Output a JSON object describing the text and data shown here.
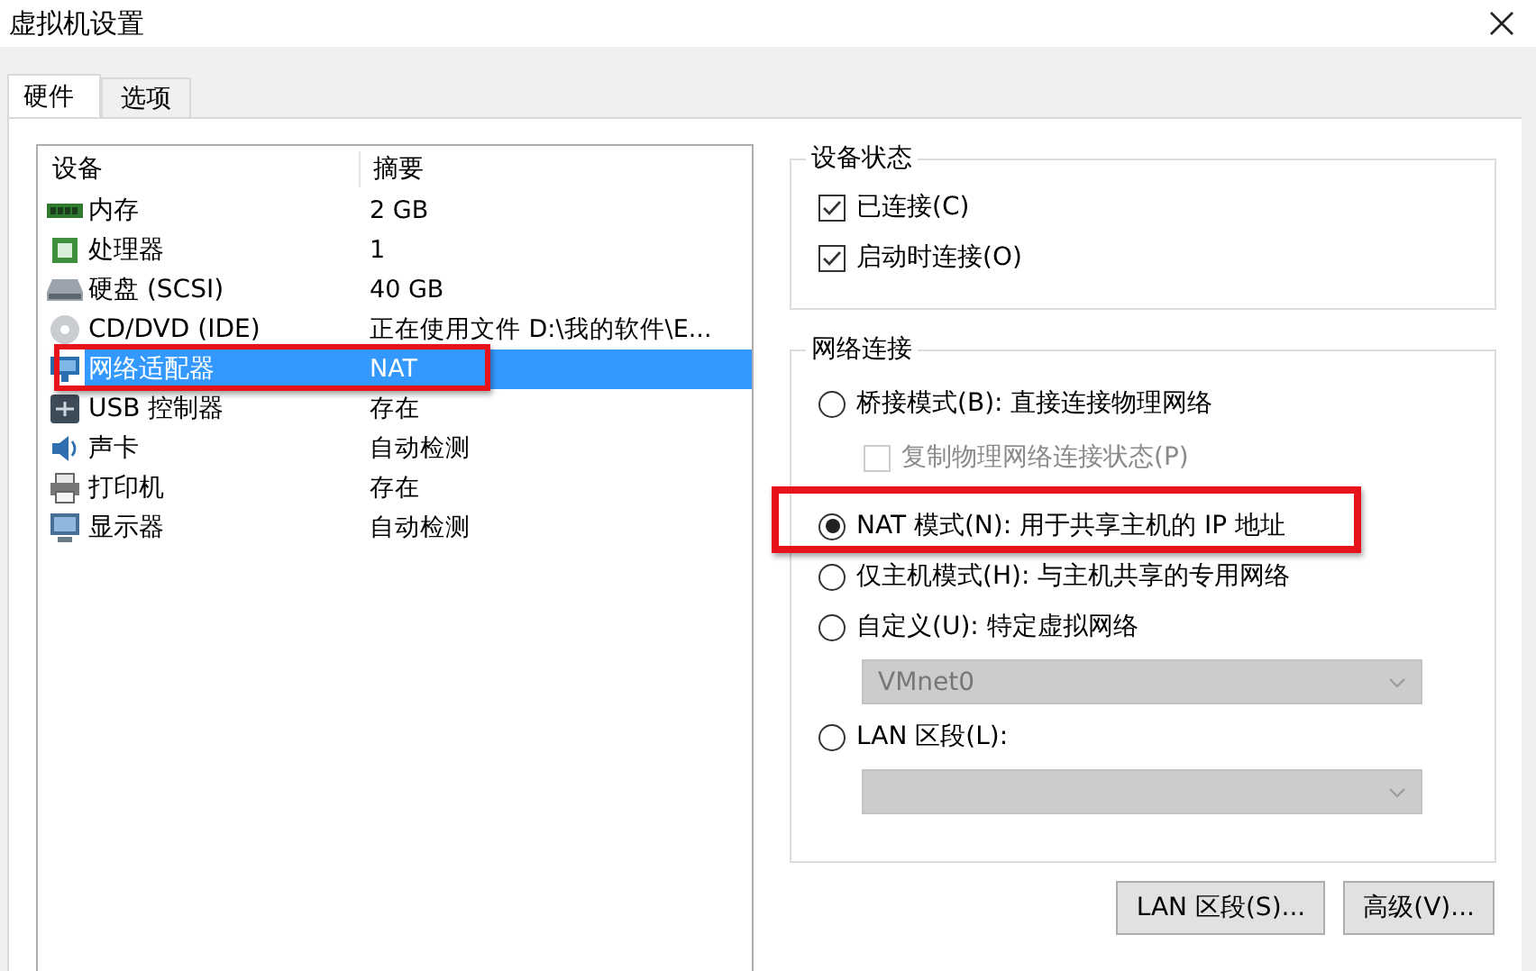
{
  "window": {
    "title": "虚拟机设置"
  },
  "tabs": [
    {
      "label": "硬件",
      "selected": true
    },
    {
      "label": "选项",
      "selected": false
    }
  ],
  "device_list": {
    "columns": [
      "设备",
      "摘要"
    ],
    "rows": [
      {
        "kind": "memory",
        "name": "内存",
        "summary": "2 GB",
        "selected": false
      },
      {
        "kind": "cpu",
        "name": "处理器",
        "summary": "1",
        "selected": false
      },
      {
        "kind": "disk",
        "name": "硬盘 (SCSI)",
        "summary": "40 GB",
        "selected": false
      },
      {
        "kind": "cdrom",
        "name": "CD/DVD (IDE)",
        "summary": "正在使用文件 D:\\我的软件\\E...",
        "selected": false
      },
      {
        "kind": "network",
        "name": "网络适配器",
        "summary": "NAT",
        "selected": true
      },
      {
        "kind": "usb",
        "name": "USB 控制器",
        "summary": "存在",
        "selected": false
      },
      {
        "kind": "sound",
        "name": "声卡",
        "summary": "自动检测",
        "selected": false
      },
      {
        "kind": "printer",
        "name": "打印机",
        "summary": "存在",
        "selected": false
      },
      {
        "kind": "display",
        "name": "显示器",
        "summary": "自动检测",
        "selected": false
      }
    ]
  },
  "device_status": {
    "title": "设备状态",
    "checkboxes": [
      {
        "label": "已连接(C)",
        "checked": true
      },
      {
        "label": "启动时连接(O)",
        "checked": true
      }
    ]
  },
  "network_connection": {
    "title": "网络连接",
    "options": [
      {
        "kind": "radio",
        "label": "桥接模式(B): 直接连接物理网络",
        "selected": false
      },
      {
        "kind": "checkbox",
        "label": "复制物理网络连接状态(P)",
        "checked": false,
        "disabled": true
      },
      {
        "kind": "radio",
        "label": "NAT 模式(N): 用于共享主机的 IP 地址",
        "selected": true
      },
      {
        "kind": "radio",
        "label": "仅主机模式(H): 与主机共享的专用网络",
        "selected": false
      },
      {
        "kind": "radio",
        "label": "自定义(U): 特定虚拟网络",
        "selected": false
      },
      {
        "kind": "dropdown",
        "value": "VMnet0",
        "disabled": true
      },
      {
        "kind": "radio",
        "label": "LAN 区段(L):",
        "selected": false
      },
      {
        "kind": "dropdown",
        "disabled": true
      }
    ]
  },
  "buttons": [
    "LAN 区段(S)...",
    "高级(V)..."
  ]
}
